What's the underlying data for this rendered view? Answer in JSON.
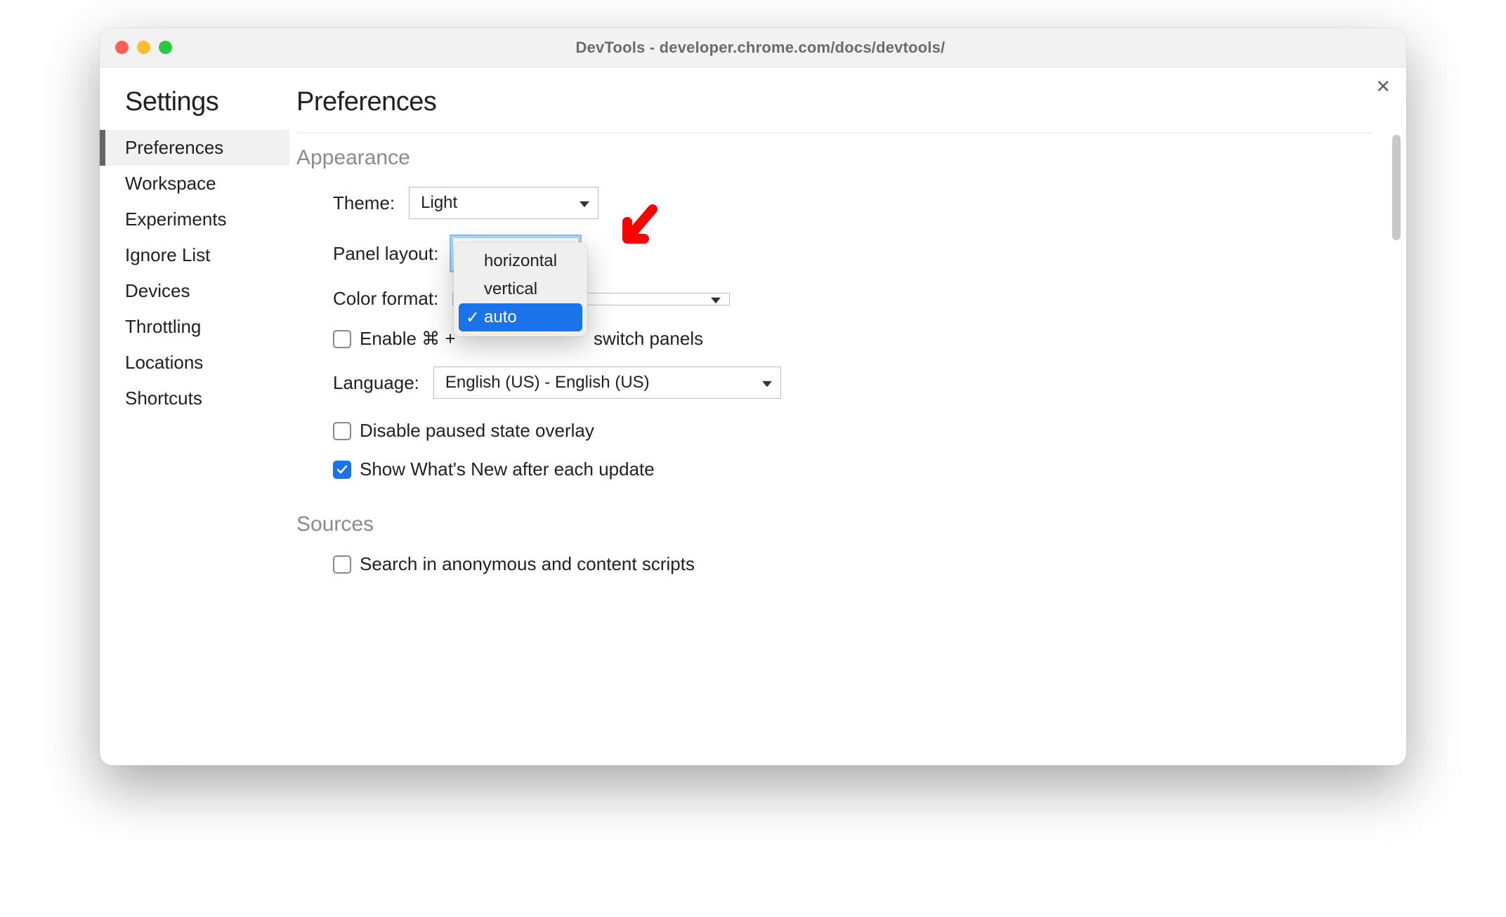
{
  "window": {
    "title": "DevTools - developer.chrome.com/docs/devtools/"
  },
  "sidebar": {
    "title": "Settings",
    "items": [
      {
        "label": "Preferences",
        "active": true
      },
      {
        "label": "Workspace"
      },
      {
        "label": "Experiments"
      },
      {
        "label": "Ignore List"
      },
      {
        "label": "Devices"
      },
      {
        "label": "Throttling"
      },
      {
        "label": "Locations"
      },
      {
        "label": "Shortcuts"
      }
    ]
  },
  "page": {
    "title": "Preferences"
  },
  "appearance": {
    "header": "Appearance",
    "theme_label": "Theme:",
    "theme_value": "Light",
    "panel_layout_label": "Panel layout:",
    "panel_layout_value": "auto",
    "panel_layout_options": [
      "horizontal",
      "vertical",
      "auto"
    ],
    "panel_layout_selected": "auto",
    "color_format_label": "Color format:",
    "color_format_value": "",
    "enable_cmd_label_prefix": "Enable ⌘ + ",
    "enable_cmd_label_suffix": " switch panels",
    "enable_cmd_checked": false,
    "language_label": "Language:",
    "language_value": "English (US) - English (US)",
    "disable_overlay_label": "Disable paused state overlay",
    "disable_overlay_checked": false,
    "whats_new_label": "Show What's New after each update",
    "whats_new_checked": true
  },
  "sources": {
    "header": "Sources",
    "search_anon_label": "Search in anonymous and content scripts",
    "search_anon_checked": false
  },
  "annotation": {
    "color": "#ff0000"
  }
}
